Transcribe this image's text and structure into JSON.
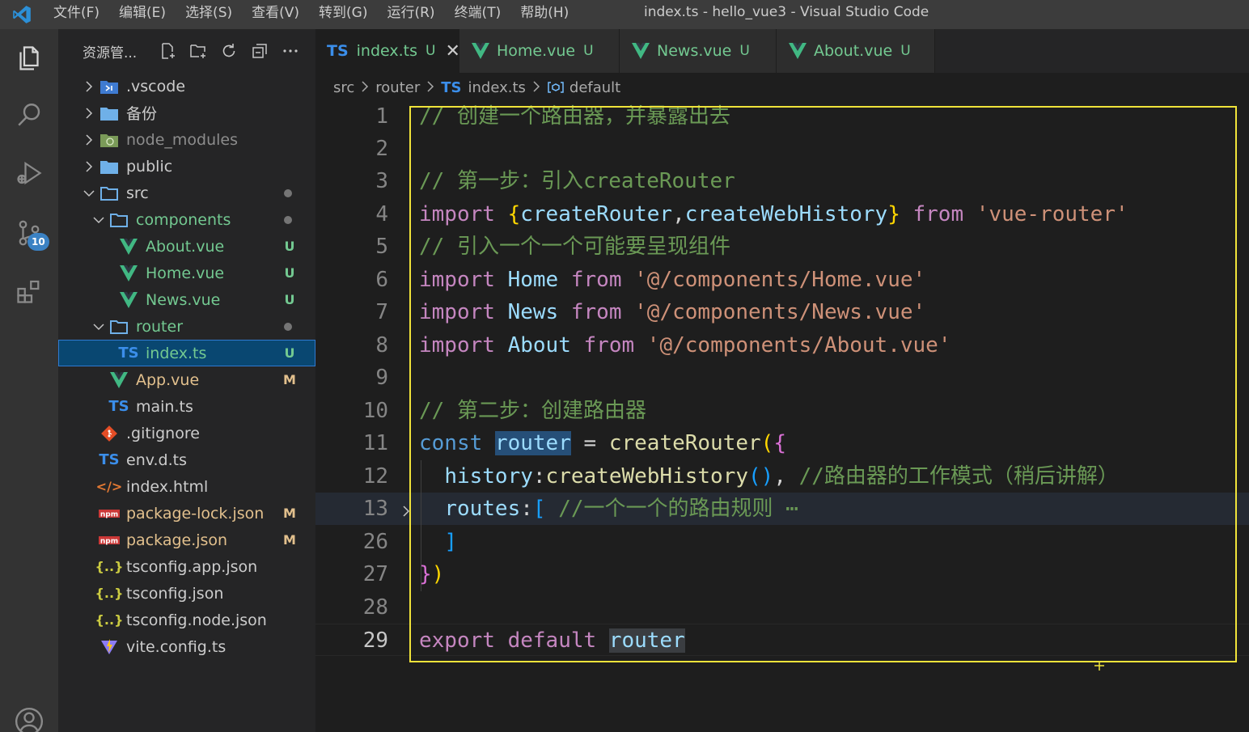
{
  "window": {
    "title": "index.ts - hello_vue3 - Visual Studio Code",
    "menu": [
      "文件(F)",
      "编辑(E)",
      "选择(S)",
      "查看(V)",
      "转到(G)",
      "运行(R)",
      "终端(T)",
      "帮助(H)"
    ]
  },
  "activity_bar": {
    "items": [
      "explorer-icon",
      "search-icon",
      "run-debug-icon",
      "source-control-icon",
      "extensions-icon",
      "account-icon"
    ],
    "source_control_badge": "10"
  },
  "sidebar": {
    "title": "资源管...",
    "actions": [
      "new-file-icon",
      "new-folder-icon",
      "refresh-icon",
      "collapse-all-icon",
      "more-icon"
    ],
    "tree": [
      {
        "label": ".vscode",
        "type": "folder",
        "expanded": false,
        "depth": 0,
        "icon": "vscode-folder",
        "status": ""
      },
      {
        "label": "备份",
        "type": "folder",
        "expanded": false,
        "depth": 0,
        "icon": "folder",
        "status": ""
      },
      {
        "label": "node_modules",
        "type": "folder",
        "expanded": false,
        "depth": 0,
        "icon": "node-folder",
        "status": "",
        "dim": true
      },
      {
        "label": "public",
        "type": "folder",
        "expanded": false,
        "depth": 0,
        "icon": "folder",
        "status": ""
      },
      {
        "label": "src",
        "type": "folder",
        "expanded": true,
        "depth": 0,
        "icon": "folder-open",
        "status": "dot"
      },
      {
        "label": "components",
        "type": "folder",
        "expanded": true,
        "depth": 1,
        "icon": "folder-open",
        "status": "dot",
        "color": "green"
      },
      {
        "label": "About.vue",
        "type": "file",
        "depth": 2,
        "icon": "vue",
        "status": "U",
        "color": "green"
      },
      {
        "label": "Home.vue",
        "type": "file",
        "depth": 2,
        "icon": "vue",
        "status": "U",
        "color": "green"
      },
      {
        "label": "News.vue",
        "type": "file",
        "depth": 2,
        "icon": "vue",
        "status": "U",
        "color": "green"
      },
      {
        "label": "router",
        "type": "folder",
        "expanded": true,
        "depth": 1,
        "icon": "folder-open",
        "status": "dot",
        "color": "green"
      },
      {
        "label": "index.ts",
        "type": "file",
        "depth": 2,
        "icon": "ts",
        "status": "U",
        "color": "green",
        "selected": true
      },
      {
        "label": "App.vue",
        "type": "file",
        "depth": 1,
        "icon": "vue",
        "status": "M",
        "color": "yellow"
      },
      {
        "label": "main.ts",
        "type": "file",
        "depth": 1,
        "icon": "ts",
        "status": ""
      },
      {
        "label": ".gitignore",
        "type": "file",
        "depth": 0,
        "icon": "git",
        "status": ""
      },
      {
        "label": "env.d.ts",
        "type": "file",
        "depth": 0,
        "icon": "ts",
        "status": ""
      },
      {
        "label": "index.html",
        "type": "file",
        "depth": 0,
        "icon": "html",
        "status": ""
      },
      {
        "label": "package-lock.json",
        "type": "file",
        "depth": 0,
        "icon": "npm",
        "status": "M",
        "color": "yellow"
      },
      {
        "label": "package.json",
        "type": "file",
        "depth": 0,
        "icon": "npm",
        "status": "M",
        "color": "yellow"
      },
      {
        "label": "tsconfig.app.json",
        "type": "file",
        "depth": 0,
        "icon": "json",
        "status": ""
      },
      {
        "label": "tsconfig.json",
        "type": "file",
        "depth": 0,
        "icon": "json",
        "status": ""
      },
      {
        "label": "tsconfig.node.json",
        "type": "file",
        "depth": 0,
        "icon": "json",
        "status": ""
      },
      {
        "label": "vite.config.ts",
        "type": "file",
        "depth": 0,
        "icon": "vite",
        "status": ""
      }
    ]
  },
  "tabs": [
    {
      "label": "index.ts",
      "icon": "TS",
      "status": "U",
      "active": true,
      "close": "✕"
    },
    {
      "label": "Home.vue",
      "icon": "vue",
      "status": "U",
      "active": false
    },
    {
      "label": "News.vue",
      "icon": "vue",
      "status": "U",
      "active": false
    },
    {
      "label": "About.vue",
      "icon": "vue",
      "status": "U",
      "active": false
    }
  ],
  "breadcrumb": {
    "parts": [
      "src",
      "router",
      "index.ts",
      "default"
    ],
    "ts_badge": "TS"
  },
  "editor": {
    "lines": [
      {
        "n": "1",
        "tokens": [
          [
            "c-com",
            "// 创建一个路由器，并暴露出去"
          ]
        ]
      },
      {
        "n": "2",
        "tokens": []
      },
      {
        "n": "3",
        "tokens": [
          [
            "c-com",
            "// 第一步：引入createRouter"
          ]
        ]
      },
      {
        "n": "4",
        "tokens": [
          [
            "c-kw",
            "import"
          ],
          [
            "c-pl",
            " "
          ],
          [
            "c-br1",
            "{"
          ],
          [
            "c-var",
            "createRouter"
          ],
          [
            "c-pl",
            ","
          ],
          [
            "c-var",
            "createWebHistory"
          ],
          [
            "c-br1",
            "}"
          ],
          [
            "c-pl",
            " "
          ],
          [
            "c-kw",
            "from"
          ],
          [
            "c-pl",
            " "
          ],
          [
            "c-str",
            "'vue-router'"
          ]
        ]
      },
      {
        "n": "5",
        "tokens": [
          [
            "c-com",
            "// 引入一个一个可能要呈现组件"
          ]
        ]
      },
      {
        "n": "6",
        "tokens": [
          [
            "c-kw",
            "import"
          ],
          [
            "c-pl",
            " "
          ],
          [
            "c-var",
            "Home"
          ],
          [
            "c-pl",
            " "
          ],
          [
            "c-kw",
            "from"
          ],
          [
            "c-pl",
            " "
          ],
          [
            "c-str",
            "'@/components/Home.vue'"
          ]
        ]
      },
      {
        "n": "7",
        "tokens": [
          [
            "c-kw",
            "import"
          ],
          [
            "c-pl",
            " "
          ],
          [
            "c-var",
            "News"
          ],
          [
            "c-pl",
            " "
          ],
          [
            "c-kw",
            "from"
          ],
          [
            "c-pl",
            " "
          ],
          [
            "c-str",
            "'@/components/News.vue'"
          ]
        ]
      },
      {
        "n": "8",
        "tokens": [
          [
            "c-kw",
            "import"
          ],
          [
            "c-pl",
            " "
          ],
          [
            "c-var",
            "About"
          ],
          [
            "c-pl",
            " "
          ],
          [
            "c-kw",
            "from"
          ],
          [
            "c-pl",
            " "
          ],
          [
            "c-str",
            "'@/components/About.vue'"
          ]
        ]
      },
      {
        "n": "9",
        "tokens": []
      },
      {
        "n": "10",
        "tokens": [
          [
            "c-com",
            "// 第二步：创建路由器"
          ]
        ]
      },
      {
        "n": "11",
        "tokens": [
          [
            "c-dec",
            "const"
          ],
          [
            "c-pl",
            " "
          ],
          [
            "c-var hl",
            "router"
          ],
          [
            "c-pl",
            " = "
          ],
          [
            "c-fn",
            "createRouter"
          ],
          [
            "c-br1",
            "("
          ],
          [
            "c-br2",
            "{"
          ]
        ]
      },
      {
        "n": "12",
        "tokens": [
          [
            "c-pl",
            "  "
          ],
          [
            "c-var",
            "history"
          ],
          [
            "c-pl",
            ":"
          ],
          [
            "c-fn",
            "createWebHistory"
          ],
          [
            "c-br3",
            "()"
          ],
          [
            "c-pl",
            ", "
          ],
          [
            "c-com",
            "//路由器的工作模式（稍后讲解）"
          ]
        ]
      },
      {
        "n": "13",
        "tokens": [
          [
            "c-pl",
            "  "
          ],
          [
            "c-var",
            "routes"
          ],
          [
            "c-pl",
            ":"
          ],
          [
            "c-br3",
            "["
          ],
          [
            "c-pl",
            " "
          ],
          [
            "c-com",
            "//一个一个的路由规则"
          ],
          [
            "c-pl",
            " "
          ],
          [
            "c-dim",
            "⋯"
          ]
        ],
        "folded": true
      },
      {
        "n": "26",
        "tokens": [
          [
            "c-pl",
            "  "
          ],
          [
            "c-br3",
            "]"
          ]
        ]
      },
      {
        "n": "27",
        "tokens": [
          [
            "c-br2",
            "}"
          ],
          [
            "c-br1",
            ")"
          ]
        ]
      },
      {
        "n": "28",
        "tokens": []
      },
      {
        "n": "29",
        "tokens": [
          [
            "c-kw",
            "export"
          ],
          [
            "c-pl",
            " "
          ],
          [
            "c-kw",
            "default"
          ],
          [
            "c-pl",
            " "
          ],
          [
            "c-var hl2",
            "router"
          ]
        ],
        "current": true
      }
    ]
  },
  "colors": {
    "accent": "#3b8eea",
    "selection_box": "#f0e33a",
    "untracked": "#73c991",
    "modified": "#e2c08d"
  }
}
